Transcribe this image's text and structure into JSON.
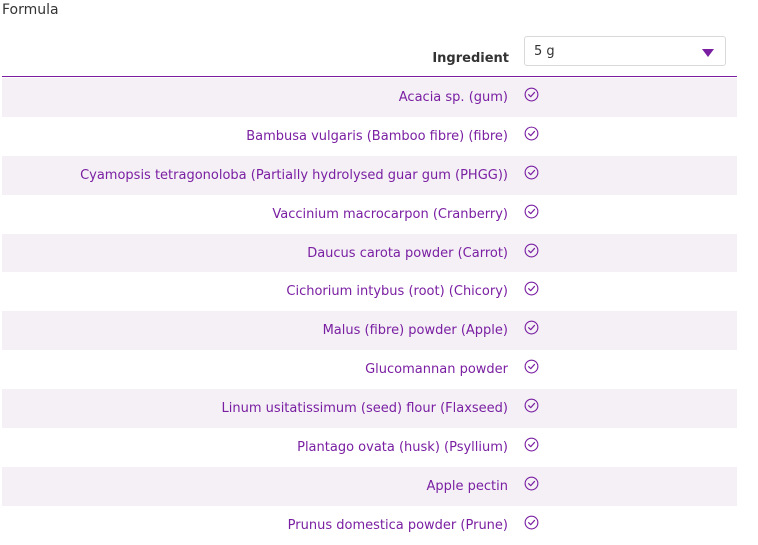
{
  "page": {
    "title": "Formula"
  },
  "table": {
    "header": {
      "label": "Ingredient",
      "dose_selected": "5 g"
    },
    "rows": [
      {
        "label": "Acacia sp. (gum)",
        "included": true
      },
      {
        "label": "Bambusa vulgaris (Bamboo fibre) (fibre)",
        "included": true
      },
      {
        "label": "Cyamopsis tetragonoloba (Partially hydrolysed guar gum (PHGG))",
        "included": true
      },
      {
        "label": "Vaccinium macrocarpon (Cranberry)",
        "included": true
      },
      {
        "label": "Daucus carota powder (Carrot)",
        "included": true
      },
      {
        "label": "Cichorium intybus (root) (Chicory)",
        "included": true
      },
      {
        "label": "Malus (fibre) powder (Apple)",
        "included": true
      },
      {
        "label": "Glucomannan powder",
        "included": true
      },
      {
        "label": "Linum usitatissimum (seed) flour (Flaxseed)",
        "included": true
      },
      {
        "label": "Plantago ovata (husk) (Psyllium)",
        "included": true
      },
      {
        "label": "Apple pectin",
        "included": true
      },
      {
        "label": "Prunus domestica powder (Prune)",
        "included": true
      }
    ]
  },
  "colors": {
    "accent": "#7a1fa2",
    "row_shade": "#f4f0f6",
    "text": "#333333"
  },
  "icons": {
    "check": "check-circle-icon",
    "dropdown": "chevron-down-icon"
  }
}
